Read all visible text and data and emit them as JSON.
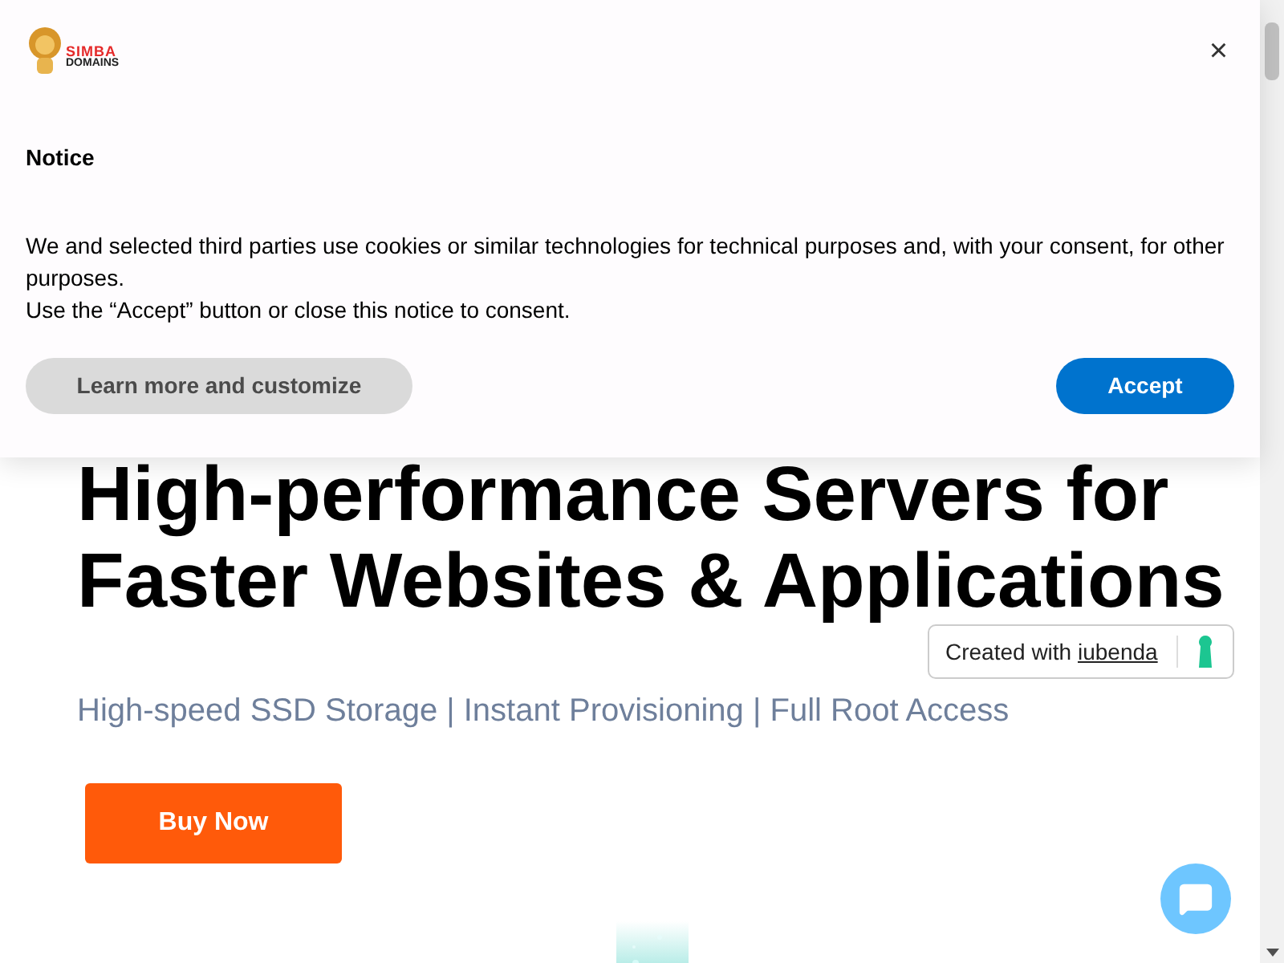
{
  "hero": {
    "heading_lines": [
      "High-performance Servers for",
      "Faster Websites & Applications"
    ],
    "subtitle": "High-speed SSD Storage | Instant Provisioning | Full Root Access",
    "button": "Buy Now"
  },
  "cookie_notice": {
    "logo": {
      "line_1": "SIMBA",
      "line_2": "DOMAINS"
    },
    "close": "×",
    "title": "Notice",
    "paragraphs": [
      "We and selected third parties use cookies or similar technologies for technical purposes and, with your consent, for other purposes.",
      "Use the “Accept” button or close this notice to consent."
    ],
    "buttons": [
      {
        "label": "Learn more and customize",
        "kind": "secondary"
      },
      {
        "label": "Accept",
        "kind": "primary"
      }
    ]
  },
  "iubenda_badge": {
    "prefix": "Created with",
    "link": "iubenda"
  }
}
